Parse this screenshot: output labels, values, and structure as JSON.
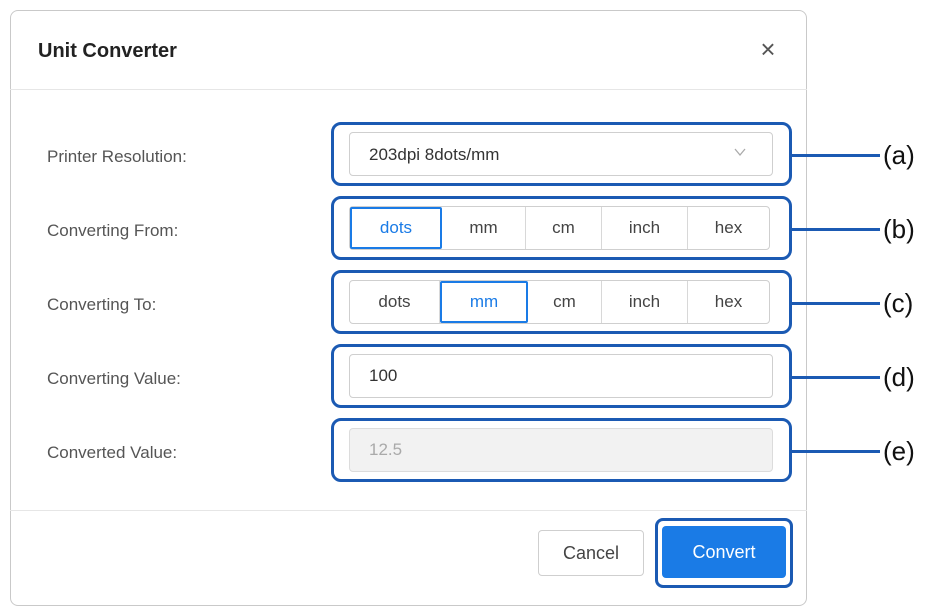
{
  "dialog": {
    "title": "Unit Converter",
    "close_glyph": "×"
  },
  "fields": {
    "printer_resolution": {
      "label": "Printer Resolution:",
      "value": "203dpi 8dots/mm",
      "callout": "(a)"
    },
    "converting_from": {
      "label": "Converting From:",
      "options": [
        "dots",
        "mm",
        "cm",
        "inch",
        "hex"
      ],
      "selected": "dots",
      "callout": "(b)"
    },
    "converting_to": {
      "label": "Converting To:",
      "options": [
        "dots",
        "mm",
        "cm",
        "inch",
        "hex"
      ],
      "selected": "mm",
      "callout": "(c)"
    },
    "converting_value": {
      "label": "Converting Value:",
      "value": "100",
      "callout": "(d)"
    },
    "converted_value": {
      "label": "Converted Value:",
      "value": "12.5",
      "callout": "(e)"
    }
  },
  "footer": {
    "cancel_label": "Cancel",
    "convert_label": "Convert"
  },
  "colors": {
    "accent": "#1a7be6",
    "highlight_border": "#1b5ab3"
  }
}
